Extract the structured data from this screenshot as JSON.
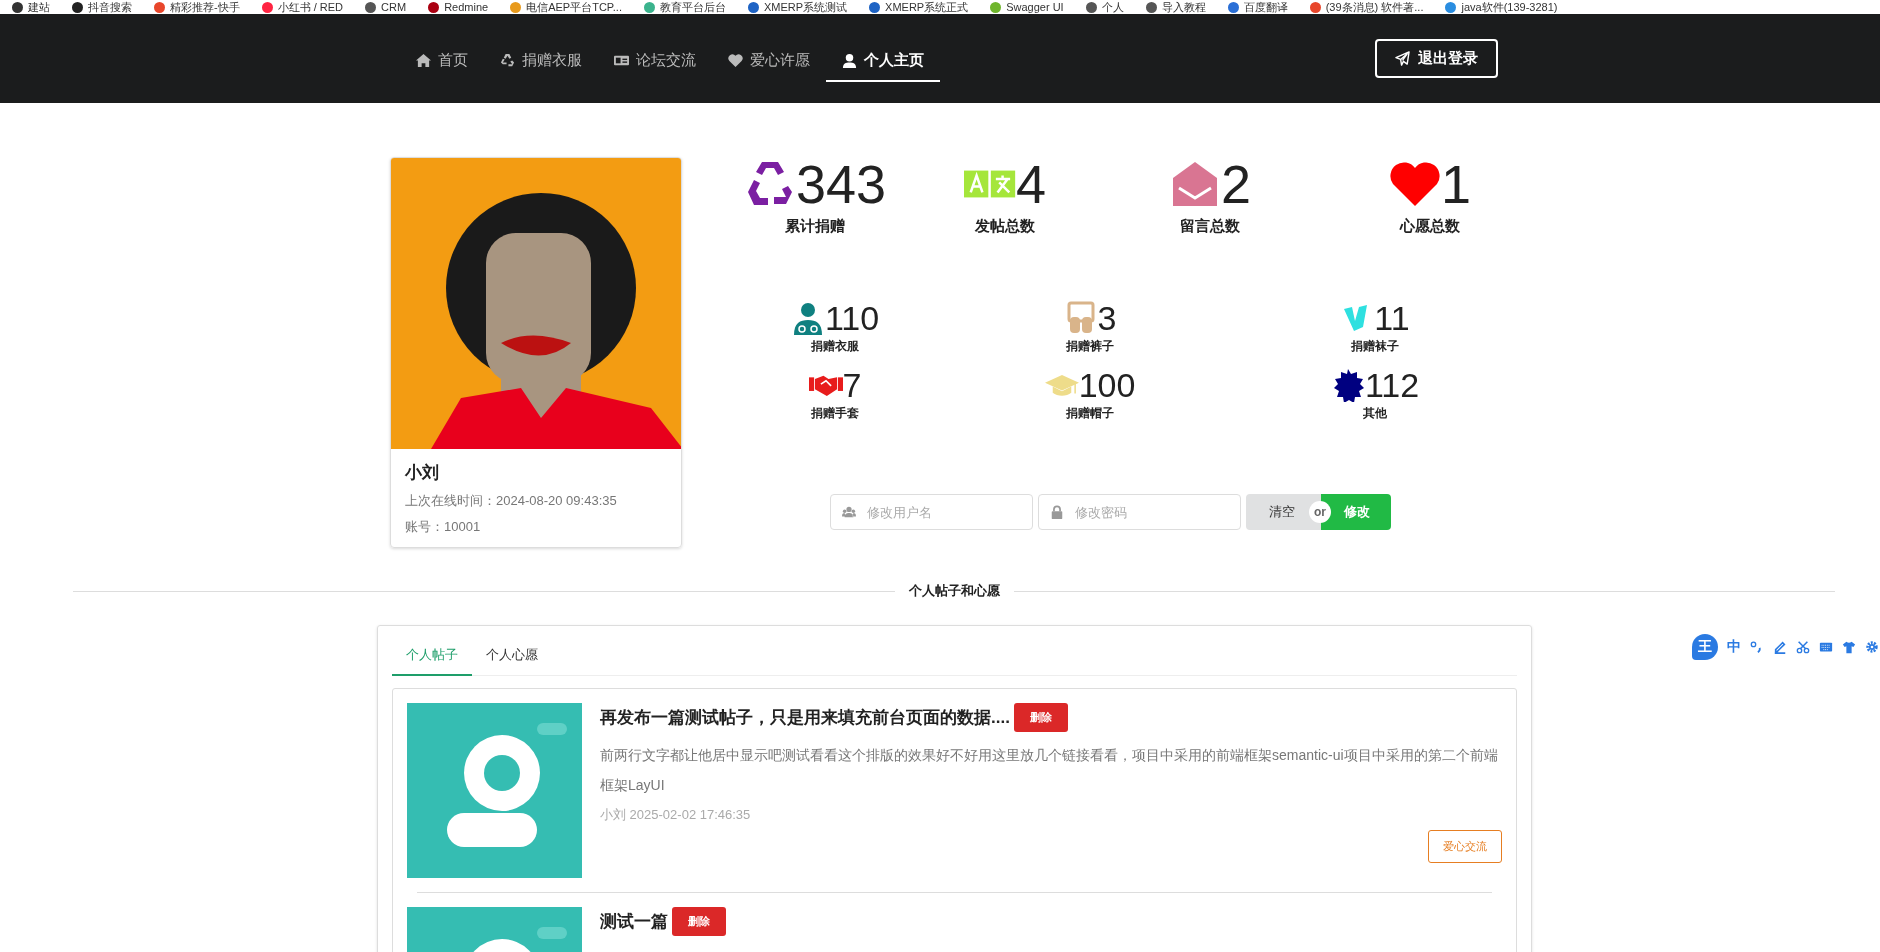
{
  "bookmarks": [
    {
      "label": "建站"
    },
    {
      "label": "抖音搜索"
    },
    {
      "label": "精彩推荐-快手"
    },
    {
      "label": "小红书 / RED"
    },
    {
      "label": "CRM"
    },
    {
      "label": "Redmine"
    },
    {
      "label": "电信AEP平台TCP..."
    },
    {
      "label": "教育平台后台"
    },
    {
      "label": "XMERP系统测试"
    },
    {
      "label": "XMERP系统正式"
    },
    {
      "label": "Swagger UI"
    },
    {
      "label": "个人"
    },
    {
      "label": "导入教程"
    },
    {
      "label": "百度翻译"
    },
    {
      "label": "(39条消息) 软件著..."
    },
    {
      "label": "java软件(139-3281)"
    }
  ],
  "nav": {
    "items": [
      {
        "label": "首页",
        "selected": false
      },
      {
        "label": "捐赠衣服",
        "selected": false
      },
      {
        "label": "论坛交流",
        "selected": false
      },
      {
        "label": "爱心许愿",
        "selected": false
      },
      {
        "label": "个人主页",
        "selected": true
      }
    ],
    "logout": "退出登录"
  },
  "profile": {
    "name": "小刘",
    "last_online": "上次在线时间：2024-08-20 09:43:35",
    "account": "账号：10001"
  },
  "stats": {
    "main": [
      {
        "value": "343",
        "label": "累计捐赠"
      },
      {
        "value": "4",
        "label": "发帖总数"
      },
      {
        "value": "2",
        "label": "留言总数"
      },
      {
        "value": "1",
        "label": "心愿总数"
      }
    ],
    "details": [
      {
        "value": "110",
        "label": "捐赠衣服"
      },
      {
        "value": "3",
        "label": "捐赠裤子"
      },
      {
        "value": "11",
        "label": "捐赠袜子"
      },
      {
        "value": "7",
        "label": "捐赠手套"
      },
      {
        "value": "100",
        "label": "捐赠帽子"
      },
      {
        "value": "112",
        "label": "其他"
      }
    ]
  },
  "form": {
    "username_placeholder": "修改用户名",
    "password_placeholder": "修改密码",
    "clear": "清空",
    "or": "or",
    "submit": "修改"
  },
  "section_title": "个人帖子和心愿",
  "tabs": [
    {
      "label": "个人帖子",
      "selected": true
    },
    {
      "label": "个人心愿",
      "selected": false
    }
  ],
  "posts": [
    {
      "title": "再发布一篇测试帖子，只是用来填充前台页面的数据....",
      "delete": "删除",
      "body": "前两行文字都让他居中显示吧测试看看这个排版的效果好不好用这里放几个链接看看，项目中采用的前端框架semantic-ui项目中采用的第二个前端框架LayUI",
      "meta": "小刘 2025-02-02 17:46:35",
      "tag": "爱心交流"
    },
    {
      "title": "测试一篇",
      "delete": "删除"
    }
  ],
  "ime_toolbar": {
    "logo": "王",
    "mode": "中"
  }
}
